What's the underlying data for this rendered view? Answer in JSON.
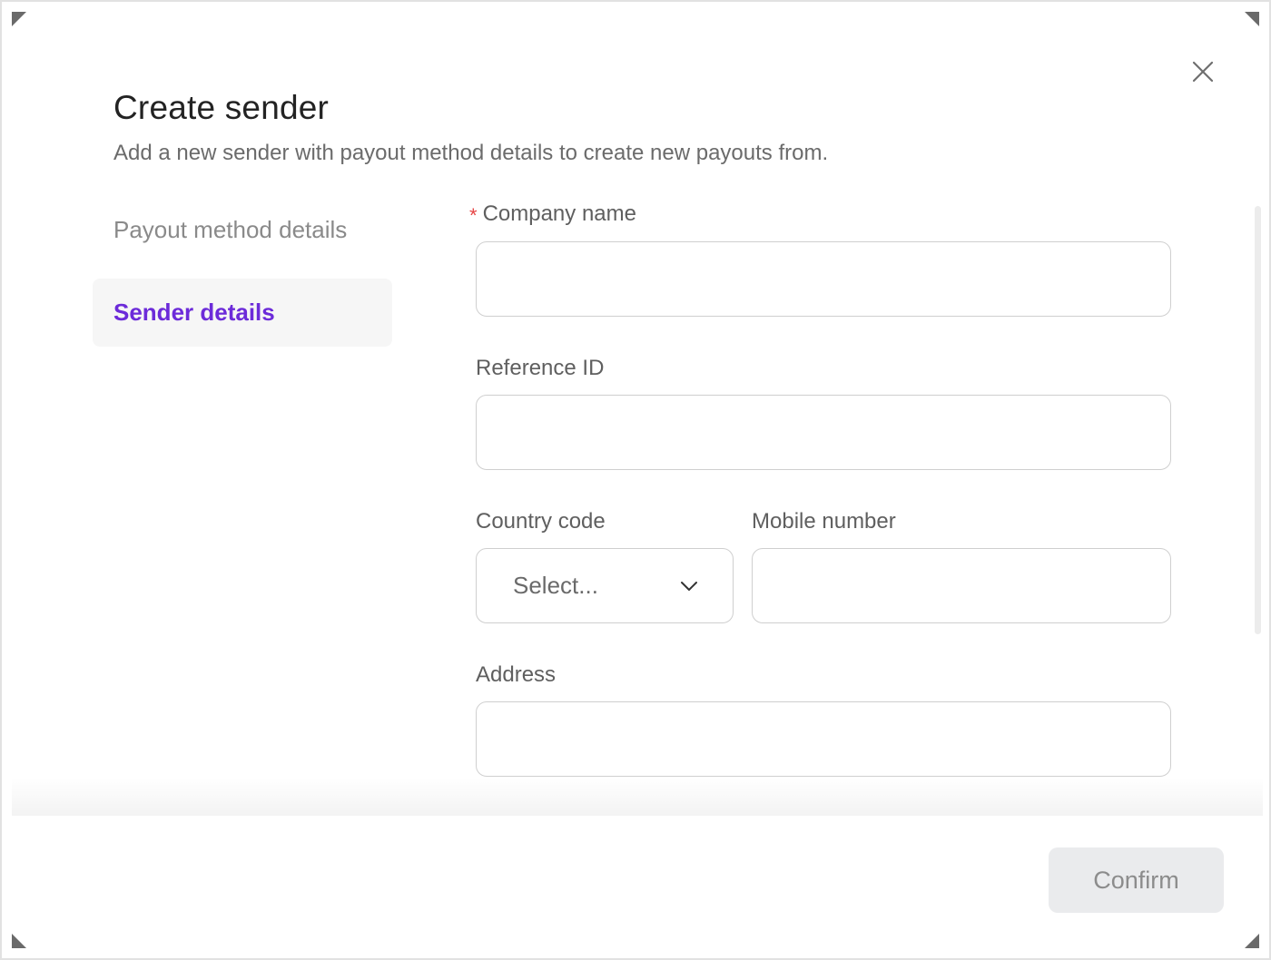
{
  "dialog": {
    "title": "Create sender",
    "subtitle": "Add a new sender with payout method details to create new payouts from."
  },
  "steps": [
    {
      "label": "Payout method details",
      "active": false
    },
    {
      "label": "Sender details",
      "active": true
    }
  ],
  "form": {
    "company_name": {
      "label": "Company name",
      "required_mark": "*",
      "value": ""
    },
    "reference_id": {
      "label": "Reference ID",
      "value": ""
    },
    "country_code": {
      "label": "Country code",
      "placeholder": "Select..."
    },
    "mobile_number": {
      "label": "Mobile number",
      "value": ""
    },
    "address": {
      "label": "Address",
      "value": ""
    }
  },
  "footer": {
    "confirm_label": "Confirm"
  },
  "colors": {
    "accent": "#6c2bd9",
    "required": "#e64545",
    "border": "#cfcfcf"
  },
  "icons": {
    "close": "close-icon",
    "dropdown": "chevron-down-icon"
  }
}
